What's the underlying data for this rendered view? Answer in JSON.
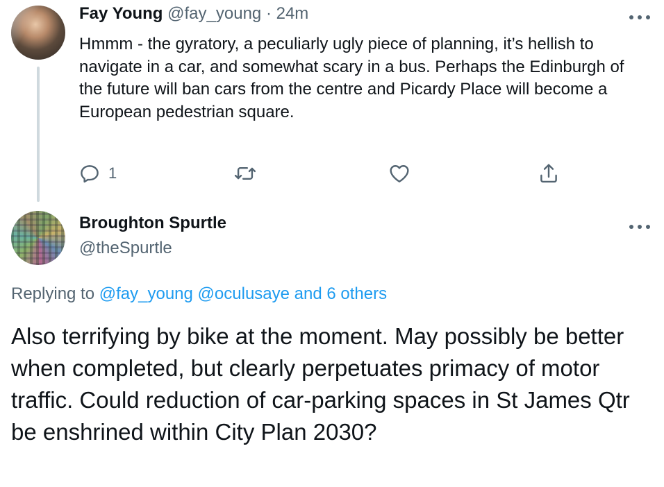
{
  "parent_tweet": {
    "author_name": "Fay Young",
    "author_handle": "@fay_young",
    "separator": "·",
    "time": "24m",
    "text": "Hmmm - the gyratory, a peculiarly ugly piece of planning, it’s hellish to navigate in a car, and somewhat scary in a bus. Perhaps the Edinburgh of the future will ban cars from the centre and Picardy Place will become a European pedestrian square.",
    "reply_count": "1",
    "icons": {
      "reply": "reply-icon",
      "retweet": "retweet-icon",
      "like": "heart-icon",
      "share": "share-icon",
      "more": "more-icon"
    }
  },
  "reply_tweet": {
    "author_name": "Broughton Spurtle",
    "author_handle": "@theSpurtle",
    "replying_prefix": "Replying to",
    "replying_user1": "@fay_young",
    "replying_user2": "@oculusaye",
    "replying_others": "and 6 others",
    "text": "Also terrifying by bike at the moment. May possibly be better when completed, but clearly perpetuates primacy of motor traffic. Could reduction of car-parking spaces in St James Qtr be enshrined within City Plan 2030?"
  },
  "colors": {
    "text": "#0f1419",
    "secondary": "#536471",
    "link": "#1d9bf0",
    "thread_line": "#cfd9de"
  }
}
